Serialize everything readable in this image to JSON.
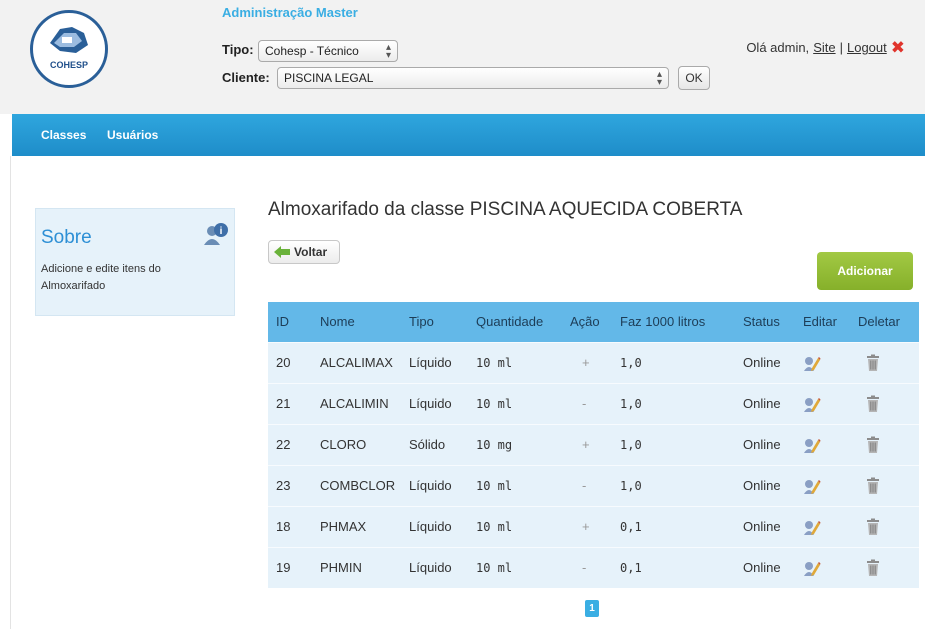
{
  "header": {
    "logo_text": "COHESP",
    "admin_title": "Administração Master",
    "tipo_label": "Tipo:",
    "tipo_value": "Cohesp - Técnico",
    "cliente_label": "Cliente:",
    "cliente_value": "PISCINA LEGAL",
    "ok_label": "OK",
    "greeting": "Olá admin,",
    "site_link": "Site",
    "separator": "|",
    "logout_link": "Logout"
  },
  "nav": {
    "items": [
      {
        "label": "Classes"
      },
      {
        "label": "Usuários"
      }
    ]
  },
  "sidebar": {
    "title": "Sobre",
    "text": "Adicione e edite itens do Almoxarifado"
  },
  "main": {
    "title": "Almoxarifado da classe PISCINA AQUECIDA COBERTA",
    "back_label": "Voltar",
    "add_label": "Adicionar",
    "columns": [
      "ID",
      "Nome",
      "Tipo",
      "Quantidade",
      "Ação",
      "Faz 1000 litros",
      "Status",
      "Editar",
      "Deletar"
    ],
    "rows": [
      {
        "id": "20",
        "nome": "ALCALIMAX",
        "tipo": "Líquido",
        "quantidade": "10 ml",
        "acao": "+",
        "faz": "1,0",
        "status": "Online"
      },
      {
        "id": "21",
        "nome": "ALCALIMIN",
        "tipo": "Líquido",
        "quantidade": "10 ml",
        "acao": "-",
        "faz": "1,0",
        "status": "Online"
      },
      {
        "id": "22",
        "nome": "CLORO",
        "tipo": "Sólido",
        "quantidade": "10 mg",
        "acao": "+",
        "faz": "1,0",
        "status": "Online"
      },
      {
        "id": "23",
        "nome": "COMBCLOR",
        "tipo": "Líquido",
        "quantidade": "10 ml",
        "acao": "-",
        "faz": "1,0",
        "status": "Online"
      },
      {
        "id": "18",
        "nome": "PHMAX",
        "tipo": "Líquido",
        "quantidade": "10 ml",
        "acao": "+",
        "faz": "0,1",
        "status": "Online"
      },
      {
        "id": "19",
        "nome": "PHMIN",
        "tipo": "Líquido",
        "quantidade": "10 ml",
        "acao": "-",
        "faz": "0,1",
        "status": "Online"
      }
    ],
    "page": "1"
  },
  "colors": {
    "accent_blue": "#2fa6de",
    "header_row": "#63b8e8",
    "row_bg": "#e6f2fa",
    "add_green": "#94bd36",
    "logout_red": "#e0342c"
  },
  "icons": {
    "edit": "pencil-icon",
    "delete": "trash-icon",
    "back": "arrow-left-icon",
    "info": "info-users-icon",
    "logout": "close-x-icon"
  }
}
